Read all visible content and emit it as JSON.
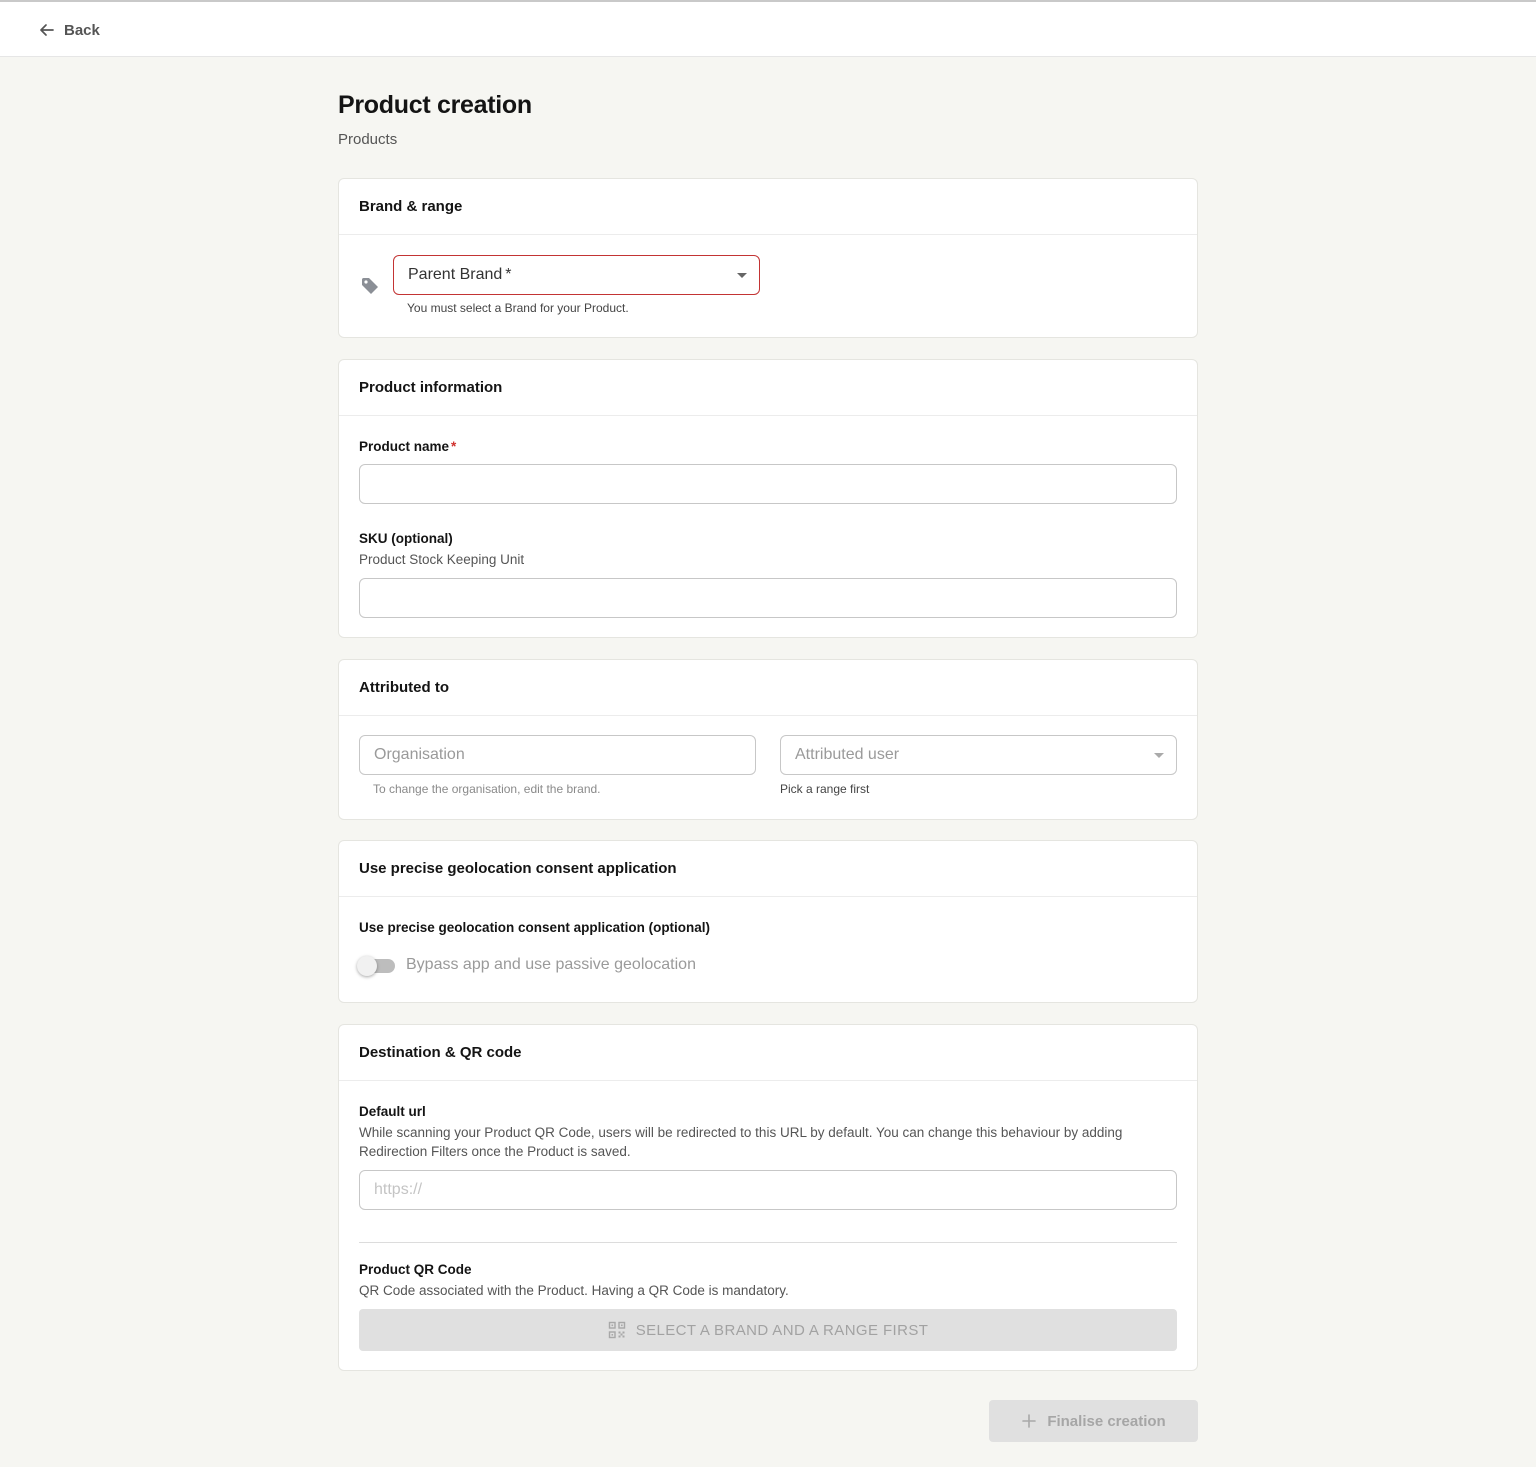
{
  "topbar": {
    "back_label": "Back"
  },
  "header": {
    "title": "Product creation",
    "subtitle": "Products"
  },
  "brand_range": {
    "heading": "Brand & range",
    "parent_brand_label": "Parent Brand",
    "parent_brand_required_mark": "*",
    "error_text": "You must select a Brand for your Product."
  },
  "product_info": {
    "heading": "Product information",
    "name_label": "Product name",
    "name_required_mark": "*",
    "name_value": "",
    "sku_label": "SKU (optional)",
    "sku_help": "Product Stock Keeping Unit",
    "sku_value": ""
  },
  "attributed": {
    "heading": "Attributed to",
    "organisation_placeholder": "Organisation",
    "organisation_help": "To change the organisation, edit the brand.",
    "user_placeholder": "Attributed user",
    "user_help": "Pick a range first"
  },
  "geolocation": {
    "heading": "Use precise geolocation consent application",
    "field_label": "Use precise geolocation consent application (optional)",
    "toggle_label": "Bypass app and use passive geolocation",
    "toggle_on": false
  },
  "destination": {
    "heading": "Destination & QR code",
    "url_label": "Default url",
    "url_help_line1": "While scanning your Product QR Code, users will be redirected to this URL by default. You can change this behaviour by adding",
    "url_help_line2": "Redirection Filters once the Product is saved.",
    "url_placeholder": "https://",
    "qr_label": "Product QR Code",
    "qr_help": "QR Code associated with the Product. Having a QR Code is mandatory.",
    "qr_button_label": "SELECT A BRAND AND A RANGE FIRST"
  },
  "footer": {
    "finalise_label": "Finalise creation"
  },
  "icons": {
    "back": "arrow-left-icon",
    "tag": "tag-icon",
    "qr": "qr-code-icon",
    "plus": "plus-icon"
  },
  "colors": {
    "error": "#c33434",
    "required": "#d0312d",
    "background": "#f6f6f2",
    "disabled_button": "#e0e0e0"
  }
}
